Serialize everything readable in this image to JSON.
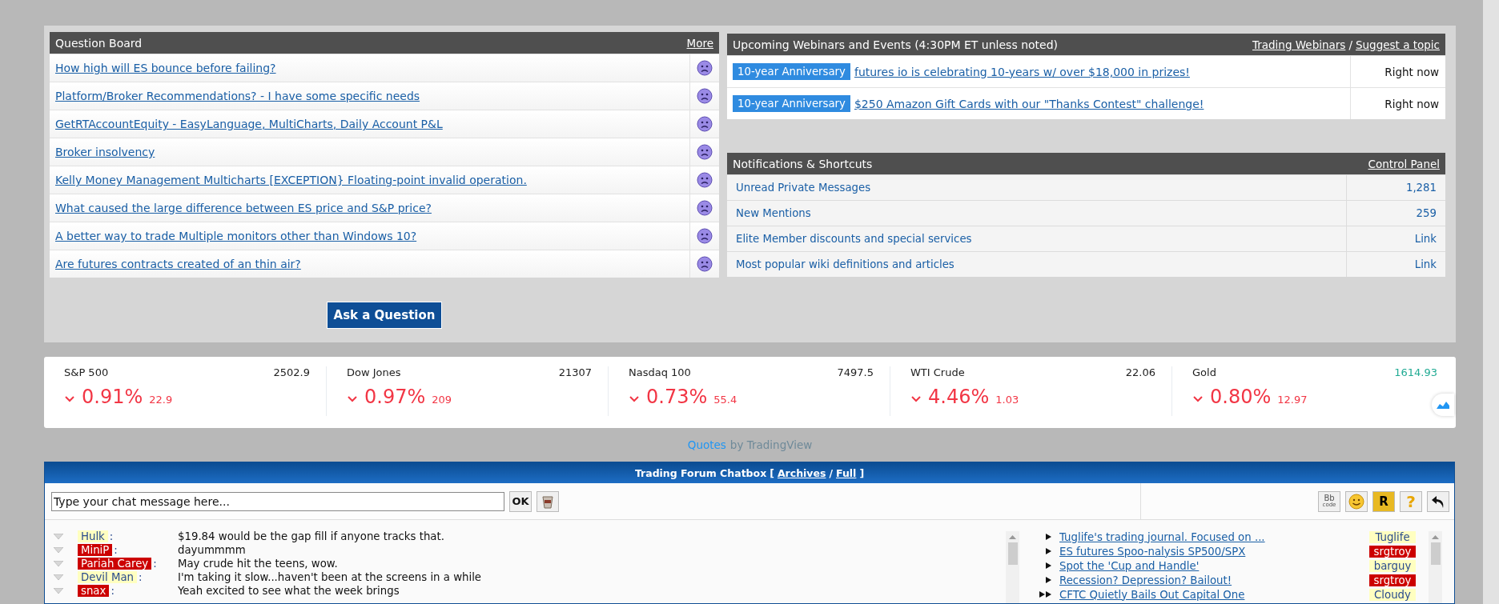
{
  "question_board": {
    "title": "Question Board",
    "more_link": "More",
    "questions": [
      {
        "title": "How high will ES bounce before failing?"
      },
      {
        "title": "Platform/Broker Recommendations? - I have some specific needs"
      },
      {
        "title": "GetRTAccountEquity - EasyLanguage, MultiCharts, Daily Account P&L"
      },
      {
        "title": "Broker insolvency"
      },
      {
        "title": "Kelly Money Management Multicharts [EXCEPTION} Floating-point invalid operation."
      },
      {
        "title": "What caused the large difference between ES price and S&P price?"
      },
      {
        "title": "A better way to trade Multiple monitors other than Windows 10?"
      },
      {
        "title": "Are futures contracts created of an thin air?"
      }
    ],
    "ask_button": "Ask a Question"
  },
  "webinars": {
    "title": "Upcoming Webinars and Events (4:30PM ET unless noted)",
    "links": [
      "Trading Webinars",
      "Suggest a topic"
    ],
    "separator": "/",
    "events": [
      {
        "tag": "10-year Anniversary",
        "title": "futures io is celebrating 10-years w/ over $18,000 in prizes!",
        "when": "Right now"
      },
      {
        "tag": "10-year Anniversary",
        "title": "$250 Amazon Gift Cards with our \"Thanks Contest\" challenge!",
        "when": "Right now"
      }
    ]
  },
  "notifications": {
    "title": "Notifications & Shortcuts",
    "link": "Control Panel",
    "rows": [
      {
        "label": "Unread Private Messages",
        "value": "1,281"
      },
      {
        "label": "New Mentions",
        "value": "259"
      },
      {
        "label": "Elite Member discounts and special services",
        "value": "Link"
      },
      {
        "label": "Most popular wiki definitions and articles",
        "value": "Link"
      }
    ]
  },
  "ticker": [
    {
      "name": "S&P 500",
      "price": "2502.9",
      "color": "#222222",
      "change_percent": "0.91%",
      "change": "22.9"
    },
    {
      "name": "Dow Jones",
      "price": "21307",
      "color": "#222222",
      "change_percent": "0.97%",
      "change": "209"
    },
    {
      "name": "Nasdaq 100",
      "price": "7497.5",
      "color": "#222222",
      "change_percent": "0.73%",
      "change": "55.4"
    },
    {
      "name": "WTI Crude",
      "price": "22.06",
      "color": "#222222",
      "change_percent": "4.46%",
      "change": "1.03"
    },
    {
      "name": "Gold",
      "price": "1614.93",
      "color": "#22ab94",
      "change_percent": "0.80%",
      "change": "12.97"
    }
  ],
  "attribution": {
    "link": "Quotes",
    "text": "by TradingView"
  },
  "chatbox": {
    "title": "Trading Forum Chatbox",
    "bracket_open": "[",
    "links": [
      "Archives",
      "Full"
    ],
    "separator": "/",
    "bracket_close": "]",
    "input": {
      "value": "Type your chat message here..."
    },
    "ok_button": "OK",
    "tools": [
      {
        "kind": "bbcode",
        "label": "Bb",
        "sublabel": "code"
      },
      {
        "kind": "smiley"
      },
      {
        "kind": "badge",
        "label": "R"
      },
      {
        "kind": "help",
        "label": "?"
      },
      {
        "kind": "undo"
      }
    ],
    "messages": [
      {
        "user": "Hulk",
        "color": "#ffffc0",
        "colon": ":",
        "text": "$19.84 would be the gap fill if anyone tracks that."
      },
      {
        "user": "MiniP",
        "color": "#cc0000",
        "colon": ":",
        "text": "dayummmm"
      },
      {
        "user": "Pariah Carey",
        "color": "#cc0000",
        "colon": ":",
        "text": "May crude hit the teens, wow."
      },
      {
        "user": "Devil Man",
        "color": "#ffffc0",
        "colon": ":",
        "text": "I'm taking it slow...haven't been at the screens in a while"
      },
      {
        "user": "snax",
        "color": "#cc0000",
        "colon": ":",
        "text": "Yeah excited to see what the week brings"
      }
    ],
    "topics": [
      {
        "title": "Tuglife's trading journal. Focused on ...",
        "kind": "single",
        "user": "Tuglife",
        "color": "#ffffc0"
      },
      {
        "title": "ES futures Spoo-nalysis SP500/SPX",
        "kind": "single",
        "user": "srgtroy",
        "color": "#cc0000"
      },
      {
        "title": "Spot the 'Cup and Handle'",
        "kind": "single",
        "user": "barguy",
        "color": "#ffffc0"
      },
      {
        "title": "Recession? Depression? Bailout!",
        "kind": "single",
        "user": "srgtroy",
        "color": "#cc0000"
      },
      {
        "title": "CFTC Quietly Bails Out Capital One",
        "kind": "double",
        "user": "Cloudy",
        "color": "#ffffc0"
      }
    ]
  }
}
